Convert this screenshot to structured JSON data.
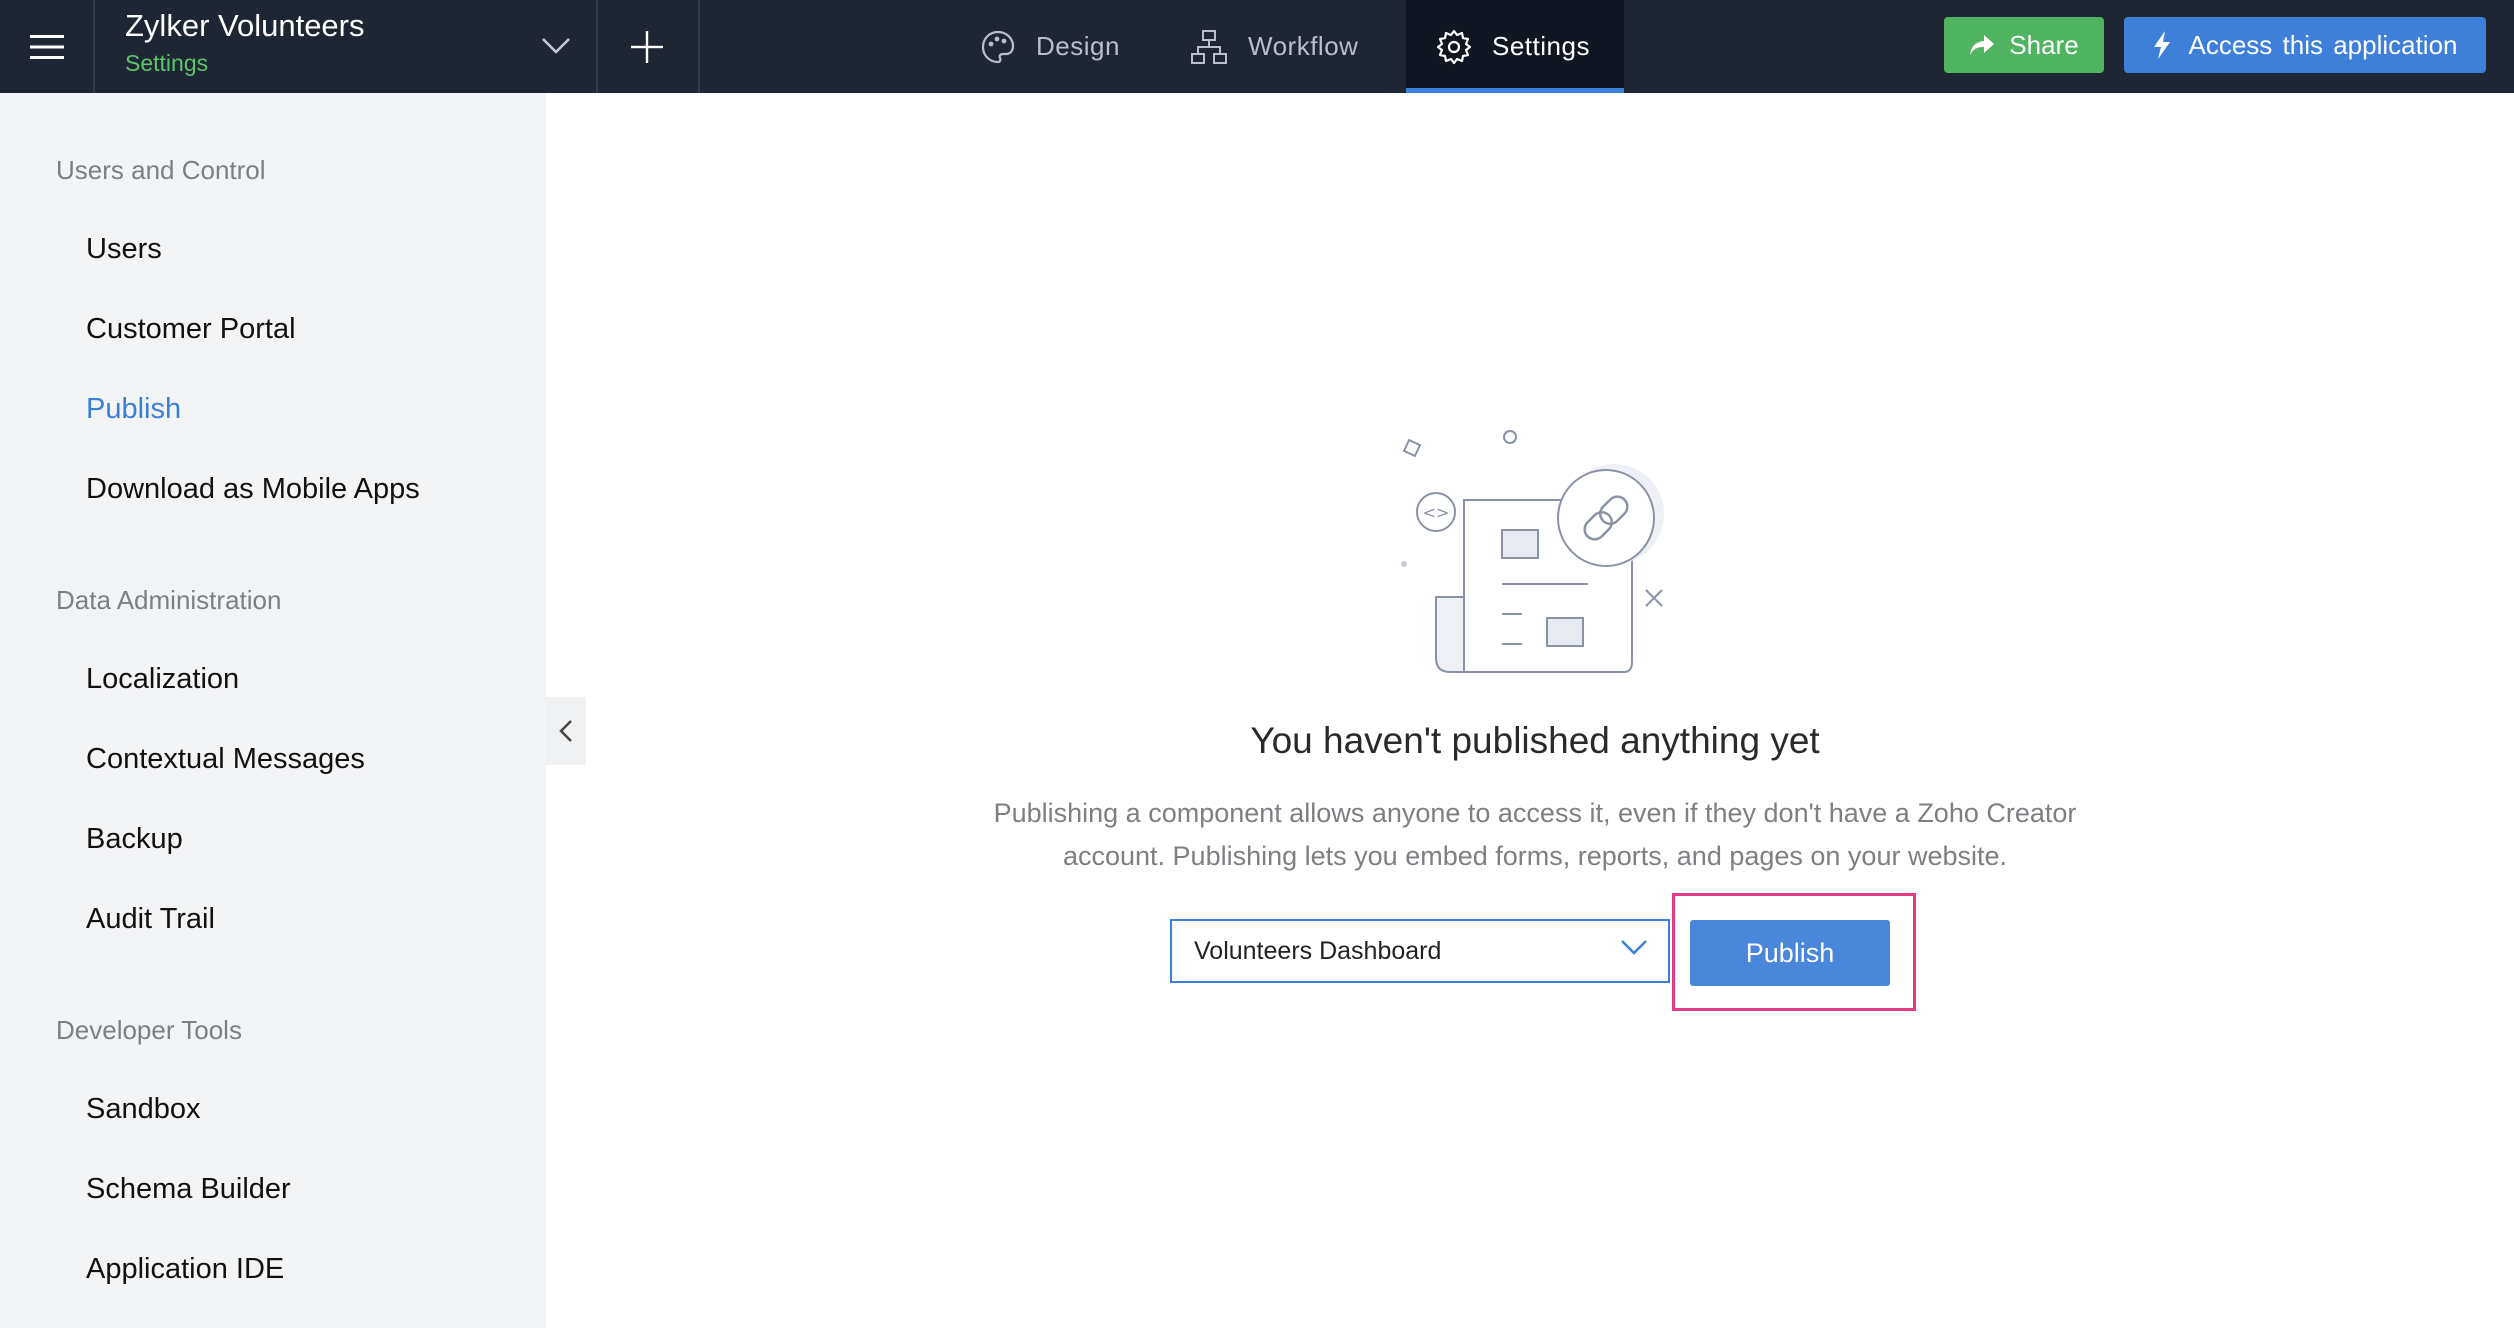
{
  "header": {
    "app_title": "Zylker Volunteers",
    "app_subtitle": "Settings",
    "tabs": [
      {
        "label": "Design",
        "icon": "palette-icon",
        "active": false
      },
      {
        "label": "Workflow",
        "icon": "workflow-icon",
        "active": false
      },
      {
        "label": "Settings",
        "icon": "gear-icon",
        "active": true
      }
    ],
    "share_label": "Share",
    "access_label": "Access this application"
  },
  "sidebar": {
    "sections": [
      {
        "title": "Users and Control",
        "items": [
          {
            "label": "Users",
            "active": false
          },
          {
            "label": "Customer Portal",
            "active": false
          },
          {
            "label": "Publish",
            "active": true
          },
          {
            "label": "Download as Mobile Apps",
            "active": false
          }
        ]
      },
      {
        "title": "Data Administration",
        "items": [
          {
            "label": "Localization",
            "active": false
          },
          {
            "label": "Contextual Messages",
            "active": false
          },
          {
            "label": "Backup",
            "active": false
          },
          {
            "label": "Audit Trail",
            "active": false
          }
        ]
      },
      {
        "title": "Developer Tools",
        "items": [
          {
            "label": "Sandbox",
            "active": false
          },
          {
            "label": "Schema Builder",
            "active": false
          },
          {
            "label": "Application IDE",
            "active": false
          }
        ]
      }
    ]
  },
  "main": {
    "empty_title": "You haven't published anything yet",
    "empty_description": "Publishing a component allows anyone to access it, even if they don't have a Zoho Creator account. Publishing lets you embed forms, reports, and pages on your website.",
    "component_select": {
      "selected": "Volunteers Dashboard"
    },
    "publish_label": "Publish"
  },
  "colors": {
    "topbar_bg": "#1f2633",
    "accent_blue": "#3b7fd9",
    "share_green": "#4fb35f",
    "highlight_pink": "#e23a83",
    "sidebar_bg": "#f3f4f6"
  }
}
